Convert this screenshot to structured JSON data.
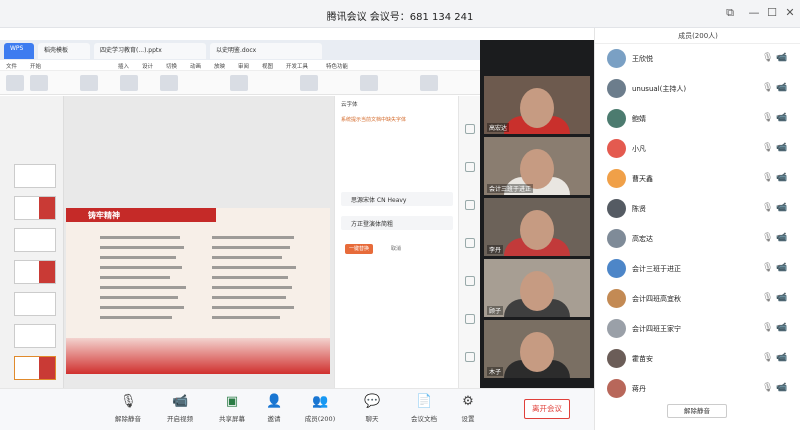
{
  "window": {
    "title": "腾讯会议  会议号：681 134 241",
    "minimize": "—",
    "maximize": "☐",
    "close": "✕",
    "restore": "⧉"
  },
  "browser": {
    "tabs": [
      {
        "label": "WPS"
      },
      {
        "label": "稻壳模板"
      },
      {
        "label": "四史学习教育(...).pptx"
      },
      {
        "label": "以史明鉴.docx"
      }
    ]
  },
  "wps_menu": [
    "文件",
    "开始",
    "插入",
    "设计",
    "切换",
    "动画",
    "放映",
    "审阅",
    "视图",
    "开发工具",
    "特色功能"
  ],
  "slide": {
    "title": "铸牢精神"
  },
  "right_pane": {
    "title": "云字体",
    "notice": "系统提示当前文档中缺失字体",
    "fonts": [
      "思源宋体 CN Heavy",
      "方正登演体简粗"
    ],
    "apply_label": "一键替换",
    "cancel_label": "取消"
  },
  "videos": [
    {
      "name": "高宏达",
      "shirt": "#c9302c",
      "bg": "#6d5a4e"
    },
    {
      "name": "会计三班于进正",
      "shirt": "#e9e6e1",
      "bg": "#8a7d70"
    },
    {
      "name": "李丹",
      "shirt": "#c23a3a",
      "bg": "#6c6259"
    },
    {
      "name": "顾子",
      "shirt": "#3f3f3f",
      "bg": "#a79e93"
    },
    {
      "name": "木子",
      "shirt": "#2c2c2c",
      "bg": "#7a6f63"
    }
  ],
  "toolbar": {
    "buttons": [
      {
        "label": "解除静音",
        "icon": "🎙"
      },
      {
        "label": "开启视频",
        "icon": "📹"
      },
      {
        "label": "共享屏幕",
        "icon": "▣"
      },
      {
        "label": "邀请",
        "icon": "👤"
      },
      {
        "label": "成员(200)",
        "icon": "👥"
      },
      {
        "label": "聊天",
        "icon": "💬"
      },
      {
        "label": "会议文档",
        "icon": "📄"
      },
      {
        "label": "设置",
        "icon": "⚙"
      }
    ],
    "leave_label": "离开会议"
  },
  "members": {
    "header": "成员(200人)",
    "list": [
      {
        "name": "王欣悦",
        "avatar_color": "#7aa0c4",
        "mic": "🎙",
        "cam": "📹"
      },
      {
        "name": "unusual(主持人)",
        "avatar_color": "#6c7d8c",
        "mic": "🎙",
        "cam": "📹"
      },
      {
        "name": "鲍婧",
        "avatar_color": "#4c7b6f",
        "mic": "🎙",
        "cam": "📹"
      },
      {
        "name": "小凡",
        "avatar_color": "#e45a4f",
        "mic": "🎙",
        "cam": "📹"
      },
      {
        "name": "曹天鑫",
        "avatar_color": "#f0a048",
        "mic": "🎙",
        "cam": "📹"
      },
      {
        "name": "陈贤",
        "avatar_color": "#555b63",
        "mic": "🎙",
        "cam": "📹"
      },
      {
        "name": "高宏达",
        "avatar_color": "#7f8b98",
        "mic": "🎙",
        "cam": "📹"
      },
      {
        "name": "会计三班于进正",
        "avatar_color": "#4d86c8",
        "mic": "🎙",
        "cam": "📹"
      },
      {
        "name": "会计四班高宜秋",
        "avatar_color": "#c38a54",
        "mic": "🎙",
        "cam": "📹"
      },
      {
        "name": "会计四班王家宁",
        "avatar_color": "#9aa0a8",
        "mic": "🎙",
        "cam": "📹"
      },
      {
        "name": "霍苗安",
        "avatar_color": "#6b5d58",
        "mic": "🎙",
        "cam": "📹"
      },
      {
        "name": "蒋丹",
        "avatar_color": "#b8675a",
        "mic": "🎙",
        "cam": "📹"
      }
    ],
    "mute_all_label": "解除静音"
  }
}
